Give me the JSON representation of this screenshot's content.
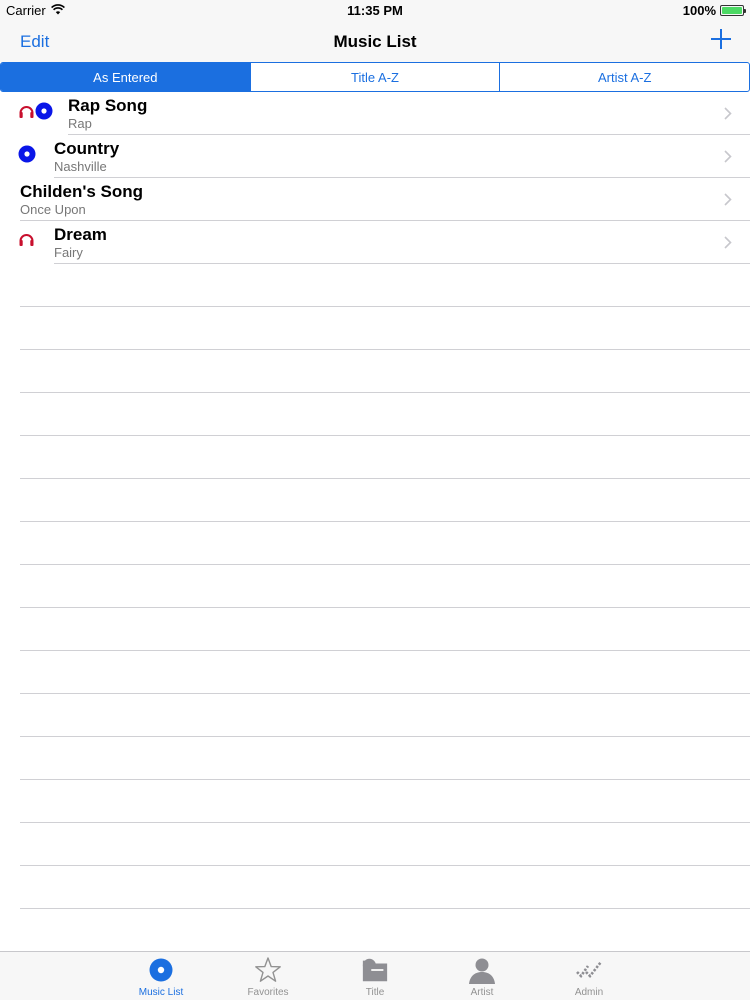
{
  "status_bar": {
    "carrier": "Carrier",
    "time": "11:35 PM",
    "battery_pct": "100%"
  },
  "nav": {
    "edit_label": "Edit",
    "title": "Music List"
  },
  "segments": [
    {
      "label": "As Entered",
      "selected": true
    },
    {
      "label": "Title A-Z",
      "selected": false
    },
    {
      "label": "Artist A-Z",
      "selected": false
    }
  ],
  "rows": [
    {
      "title": "Rap Song",
      "subtitle": "Rap",
      "icons": [
        "headphones-icon",
        "disc-icon"
      ]
    },
    {
      "title": "Country",
      "subtitle": "Nashville",
      "icons": [
        "disc-icon"
      ]
    },
    {
      "title": "Childen's Song",
      "subtitle": "Once Upon",
      "icons": []
    },
    {
      "title": "Dream",
      "subtitle": "Fairy",
      "icons": [
        "headphones-icon"
      ]
    }
  ],
  "tabs": [
    {
      "label": "Music List",
      "icon": "disc-icon",
      "active": true
    },
    {
      "label": "Favorites",
      "icon": "star-icon",
      "active": false
    },
    {
      "label": "Title",
      "icon": "folder-icon",
      "active": false
    },
    {
      "label": "Artist",
      "icon": "person-icon",
      "active": false
    },
    {
      "label": "Admin",
      "icon": "checkmarks-icon",
      "active": false
    }
  ],
  "colors": {
    "accent": "#1b6fe0",
    "disc": "#0a16e8",
    "headphones": "#c8102e"
  }
}
